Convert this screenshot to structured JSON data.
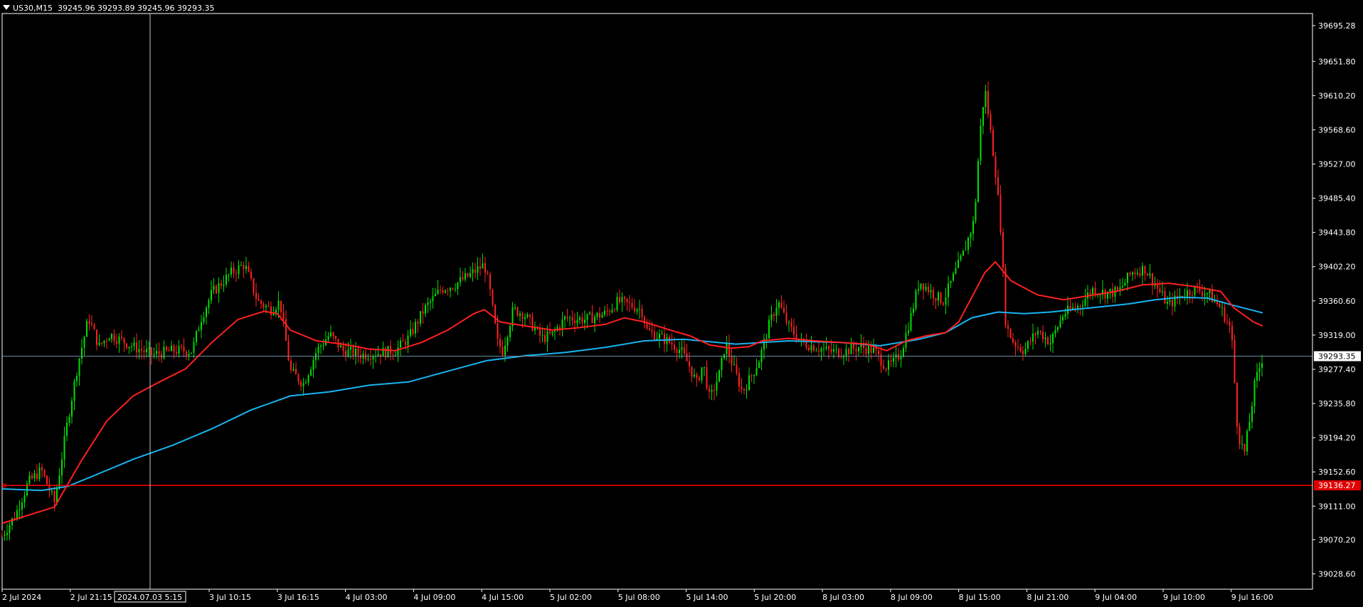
{
  "header": {
    "symbol": "US30,M15",
    "ohlc": "39245.96 39293.89 39245.96 39293.35"
  },
  "colors": {
    "background": "#000000",
    "frame": "#ffffff",
    "bull": "#00e000",
    "bear": "#ff2020",
    "ma_fast": "#ff2020",
    "ma_slow": "#19b4f0",
    "bid_line": "#6e8aa0",
    "level_line": "#ff0000",
    "crosshair": "#c8c8c8"
  },
  "crosshair": {
    "time_label": "2024.07.03 5:15"
  },
  "chart_data": {
    "type": "candlestick",
    "title": "US30,M15",
    "ylim": [
      39010,
      39710
    ],
    "y_ticks": [
      "39695.28",
      "39651.80",
      "39610.20",
      "39568.60",
      "39527.00",
      "39485.40",
      "39443.80",
      "39402.20",
      "39360.60",
      "39319.00",
      "39277.40",
      "39235.80",
      "39194.20",
      "39152.60",
      "39111.00",
      "39070.20",
      "39028.60"
    ],
    "x_ticks": [
      "2 Jul 2024",
      "2 Jul 21:15",
      "3 Jul 10:15",
      "3 Jul 16:15",
      "4 Jul 03:00",
      "4 Jul 09:00",
      "4 Jul 15:00",
      "5 Jul 02:00",
      "5 Jul 08:00",
      "5 Jul 14:00",
      "5 Jul 20:00",
      "8 Jul 03:00",
      "8 Jul 09:00",
      "8 Jul 15:00",
      "8 Jul 21:00",
      "9 Jul 04:00",
      "9 Jul 10:00",
      "9 Jul 16:00"
    ],
    "x_tick_pos": [
      0.0,
      0.052,
      0.158,
      0.21,
      0.262,
      0.314,
      0.366,
      0.418,
      0.47,
      0.522,
      0.574,
      0.626,
      0.678,
      0.73,
      0.782,
      0.834,
      0.886,
      0.938
    ],
    "current_price": "39293.35",
    "horizontal_level": "39136.27",
    "close_path": [
      [
        0.0,
        39075
      ],
      [
        0.01,
        39100
      ],
      [
        0.02,
        39140
      ],
      [
        0.03,
        39155
      ],
      [
        0.04,
        39115
      ],
      [
        0.05,
        39215
      ],
      [
        0.058,
        39285
      ],
      [
        0.066,
        39340
      ],
      [
        0.074,
        39305
      ],
      [
        0.082,
        39320
      ],
      [
        0.1,
        39305
      ],
      [
        0.115,
        39295
      ],
      [
        0.13,
        39300
      ],
      [
        0.145,
        39300
      ],
      [
        0.152,
        39340
      ],
      [
        0.16,
        39370
      ],
      [
        0.175,
        39395
      ],
      [
        0.185,
        39405
      ],
      [
        0.195,
        39360
      ],
      [
        0.205,
        39350
      ],
      [
        0.212,
        39360
      ],
      [
        0.22,
        39275
      ],
      [
        0.23,
        39260
      ],
      [
        0.24,
        39300
      ],
      [
        0.25,
        39320
      ],
      [
        0.26,
        39300
      ],
      [
        0.275,
        39295
      ],
      [
        0.29,
        39298
      ],
      [
        0.3,
        39300
      ],
      [
        0.31,
        39315
      ],
      [
        0.322,
        39350
      ],
      [
        0.335,
        39375
      ],
      [
        0.345,
        39380
      ],
      [
        0.355,
        39390
      ],
      [
        0.368,
        39405
      ],
      [
        0.372,
        39375
      ],
      [
        0.378,
        39310
      ],
      [
        0.382,
        39300
      ],
      [
        0.39,
        39350
      ],
      [
        0.398,
        39345
      ],
      [
        0.405,
        39330
      ],
      [
        0.412,
        39315
      ],
      [
        0.42,
        39320
      ],
      [
        0.43,
        39340
      ],
      [
        0.445,
        39338
      ],
      [
        0.46,
        39345
      ],
      [
        0.47,
        39360
      ],
      [
        0.48,
        39355
      ],
      [
        0.488,
        39350
      ],
      [
        0.492,
        39325
      ],
      [
        0.5,
        39318
      ],
      [
        0.51,
        39310
      ],
      [
        0.518,
        39300
      ],
      [
        0.525,
        39280
      ],
      [
        0.53,
        39260
      ],
      [
        0.535,
        39285
      ],
      [
        0.54,
        39240
      ],
      [
        0.548,
        39275
      ],
      [
        0.552,
        39310
      ],
      [
        0.558,
        39280
      ],
      [
        0.565,
        39250
      ],
      [
        0.572,
        39270
      ],
      [
        0.578,
        39290
      ],
      [
        0.585,
        39330
      ],
      [
        0.592,
        39360
      ],
      [
        0.6,
        39330
      ],
      [
        0.61,
        39310
      ],
      [
        0.62,
        39305
      ],
      [
        0.63,
        39300
      ],
      [
        0.64,
        39298
      ],
      [
        0.655,
        39305
      ],
      [
        0.665,
        39300
      ],
      [
        0.675,
        39280
      ],
      [
        0.68,
        39285
      ],
      [
        0.686,
        39298
      ],
      [
        0.694,
        39345
      ],
      [
        0.7,
        39385
      ],
      [
        0.71,
        39370
      ],
      [
        0.718,
        39360
      ],
      [
        0.726,
        39390
      ],
      [
        0.734,
        39420
      ],
      [
        0.742,
        39460
      ],
      [
        0.746,
        39560
      ],
      [
        0.75,
        39620
      ],
      [
        0.754,
        39570
      ],
      [
        0.758,
        39520
      ],
      [
        0.762,
        39450
      ],
      [
        0.766,
        39330
      ],
      [
        0.772,
        39310
      ],
      [
        0.78,
        39300
      ],
      [
        0.79,
        39325
      ],
      [
        0.8,
        39310
      ],
      [
        0.81,
        39345
      ],
      [
        0.822,
        39355
      ],
      [
        0.832,
        39375
      ],
      [
        0.842,
        39370
      ],
      [
        0.852,
        39372
      ],
      [
        0.862,
        39395
      ],
      [
        0.872,
        39400
      ],
      [
        0.882,
        39375
      ],
      [
        0.89,
        39355
      ],
      [
        0.9,
        39368
      ],
      [
        0.91,
        39375
      ],
      [
        0.92,
        39370
      ],
      [
        0.93,
        39352
      ],
      [
        0.938,
        39325
      ],
      [
        0.943,
        39200
      ],
      [
        0.948,
        39175
      ],
      [
        0.952,
        39215
      ],
      [
        0.956,
        39260
      ],
      [
        0.962,
        39293
      ]
    ],
    "ma_fast_path": [
      [
        0.0,
        39090
      ],
      [
        0.04,
        39110
      ],
      [
        0.06,
        39165
      ],
      [
        0.08,
        39215
      ],
      [
        0.1,
        39245
      ],
      [
        0.12,
        39262
      ],
      [
        0.14,
        39278
      ],
      [
        0.16,
        39310
      ],
      [
        0.18,
        39338
      ],
      [
        0.2,
        39348
      ],
      [
        0.21,
        39345
      ],
      [
        0.22,
        39325
      ],
      [
        0.24,
        39312
      ],
      [
        0.26,
        39308
      ],
      [
        0.28,
        39302
      ],
      [
        0.3,
        39300
      ],
      [
        0.32,
        39310
      ],
      [
        0.34,
        39325
      ],
      [
        0.36,
        39345
      ],
      [
        0.368,
        39350
      ],
      [
        0.38,
        39335
      ],
      [
        0.4,
        39330
      ],
      [
        0.42,
        39325
      ],
      [
        0.44,
        39328
      ],
      [
        0.46,
        39332
      ],
      [
        0.475,
        39340
      ],
      [
        0.49,
        39335
      ],
      [
        0.51,
        39325
      ],
      [
        0.525,
        39318
      ],
      [
        0.54,
        39307
      ],
      [
        0.556,
        39303
      ],
      [
        0.57,
        39305
      ],
      [
        0.58,
        39312
      ],
      [
        0.6,
        39315
      ],
      [
        0.62,
        39312
      ],
      [
        0.64,
        39310
      ],
      [
        0.66,
        39308
      ],
      [
        0.675,
        39300
      ],
      [
        0.69,
        39312
      ],
      [
        0.705,
        39318
      ],
      [
        0.72,
        39322
      ],
      [
        0.73,
        39335
      ],
      [
        0.74,
        39365
      ],
      [
        0.75,
        39395
      ],
      [
        0.758,
        39408
      ],
      [
        0.77,
        39385
      ],
      [
        0.79,
        39368
      ],
      [
        0.81,
        39362
      ],
      [
        0.83,
        39367
      ],
      [
        0.85,
        39372
      ],
      [
        0.87,
        39380
      ],
      [
        0.89,
        39382
      ],
      [
        0.91,
        39378
      ],
      [
        0.93,
        39372
      ],
      [
        0.94,
        39352
      ],
      [
        0.955,
        39335
      ],
      [
        0.962,
        39330
      ]
    ],
    "ma_slow_path": [
      [
        0.0,
        39132
      ],
      [
        0.03,
        39130
      ],
      [
        0.05,
        39135
      ],
      [
        0.07,
        39148
      ],
      [
        0.1,
        39168
      ],
      [
        0.13,
        39185
      ],
      [
        0.16,
        39205
      ],
      [
        0.19,
        39228
      ],
      [
        0.22,
        39245
      ],
      [
        0.25,
        39250
      ],
      [
        0.28,
        39258
      ],
      [
        0.31,
        39262
      ],
      [
        0.34,
        39275
      ],
      [
        0.37,
        39288
      ],
      [
        0.4,
        39294
      ],
      [
        0.43,
        39298
      ],
      [
        0.46,
        39304
      ],
      [
        0.49,
        39312
      ],
      [
        0.52,
        39314
      ],
      [
        0.56,
        39308
      ],
      [
        0.6,
        39312
      ],
      [
        0.64,
        39310
      ],
      [
        0.67,
        39306
      ],
      [
        0.7,
        39314
      ],
      [
        0.72,
        39322
      ],
      [
        0.74,
        39340
      ],
      [
        0.76,
        39347
      ],
      [
        0.78,
        39345
      ],
      [
        0.8,
        39347
      ],
      [
        0.83,
        39352
      ],
      [
        0.86,
        39357
      ],
      [
        0.88,
        39362
      ],
      [
        0.9,
        39365
      ],
      [
        0.92,
        39364
      ],
      [
        0.94,
        39355
      ],
      [
        0.962,
        39346
      ]
    ]
  }
}
